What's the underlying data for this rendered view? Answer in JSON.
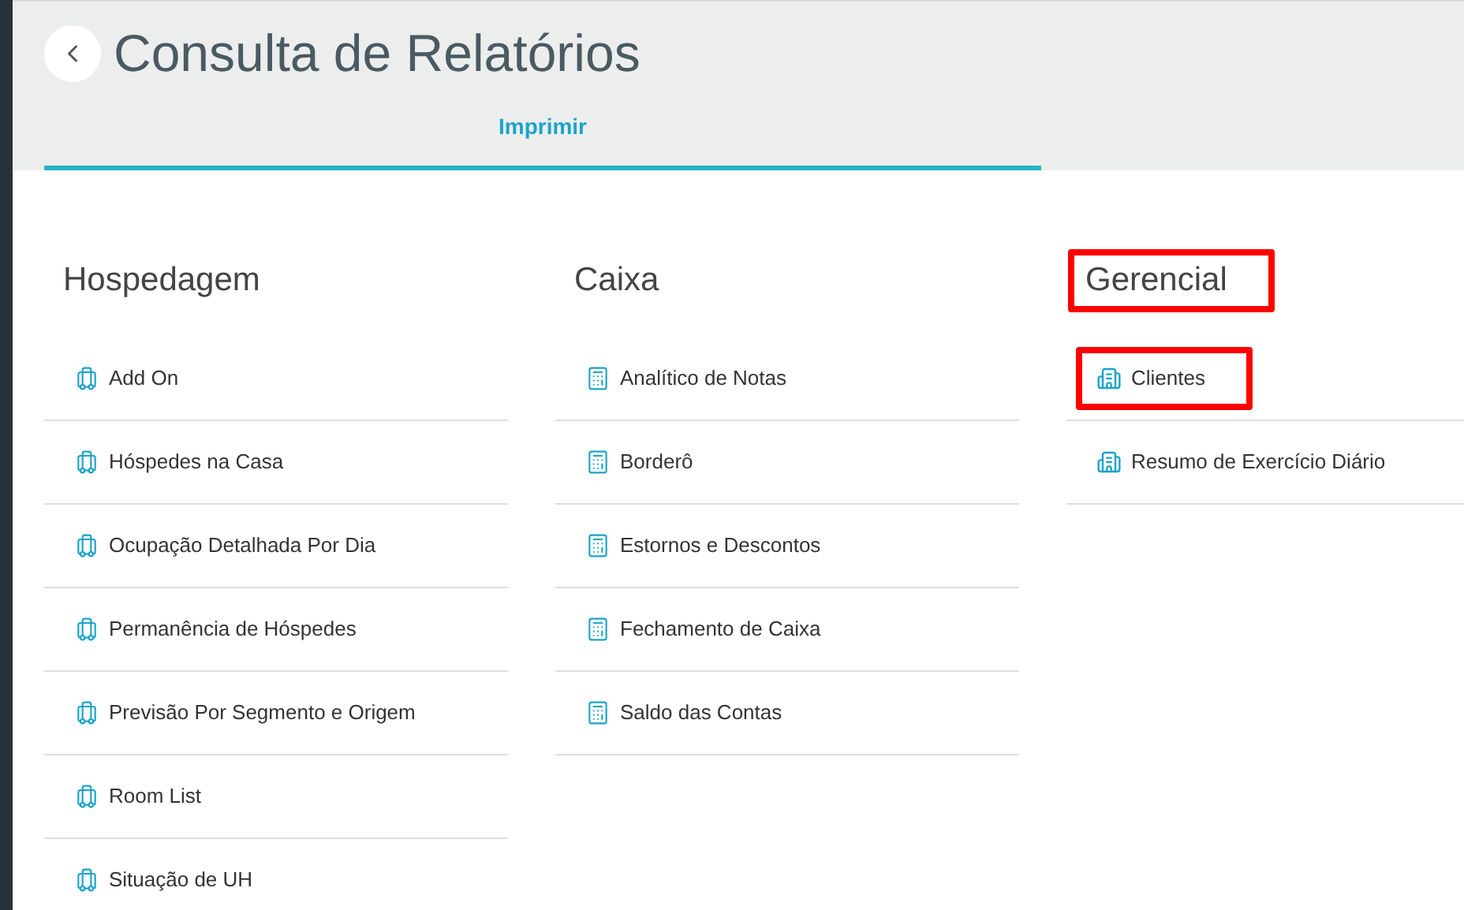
{
  "header": {
    "title": "Consulta de Relatórios"
  },
  "tabs": [
    {
      "label": "Imprimir",
      "selected": true
    }
  ],
  "columns": [
    {
      "kind": "luggage",
      "heading": "Hospedagem",
      "highlighted": false,
      "items": [
        {
          "label": "Add On",
          "highlighted": false
        },
        {
          "label": "Hóspedes na Casa",
          "highlighted": false
        },
        {
          "label": "Ocupação Detalhada Por Dia",
          "highlighted": false
        },
        {
          "label": "Permanência de Hóspedes",
          "highlighted": false
        },
        {
          "label": "Previsão Por Segmento e Origem",
          "highlighted": false
        },
        {
          "label": "Room List",
          "highlighted": false
        },
        {
          "label": "Situação de UH",
          "highlighted": false
        }
      ]
    },
    {
      "kind": "calculator",
      "heading": "Caixa",
      "highlighted": false,
      "items": [
        {
          "label": "Analítico de Notas",
          "highlighted": false
        },
        {
          "label": "Borderô",
          "highlighted": false
        },
        {
          "label": "Estornos e Descontos",
          "highlighted": false
        },
        {
          "label": "Fechamento de Caixa",
          "highlighted": false
        },
        {
          "label": "Saldo das Contas",
          "highlighted": false
        }
      ]
    },
    {
      "kind": "building",
      "heading": "Gerencial",
      "highlighted": true,
      "items": [
        {
          "label": "Clientes",
          "highlighted": true
        },
        {
          "label": "Resumo de Exercício Diário",
          "highlighted": false
        }
      ]
    }
  ]
}
